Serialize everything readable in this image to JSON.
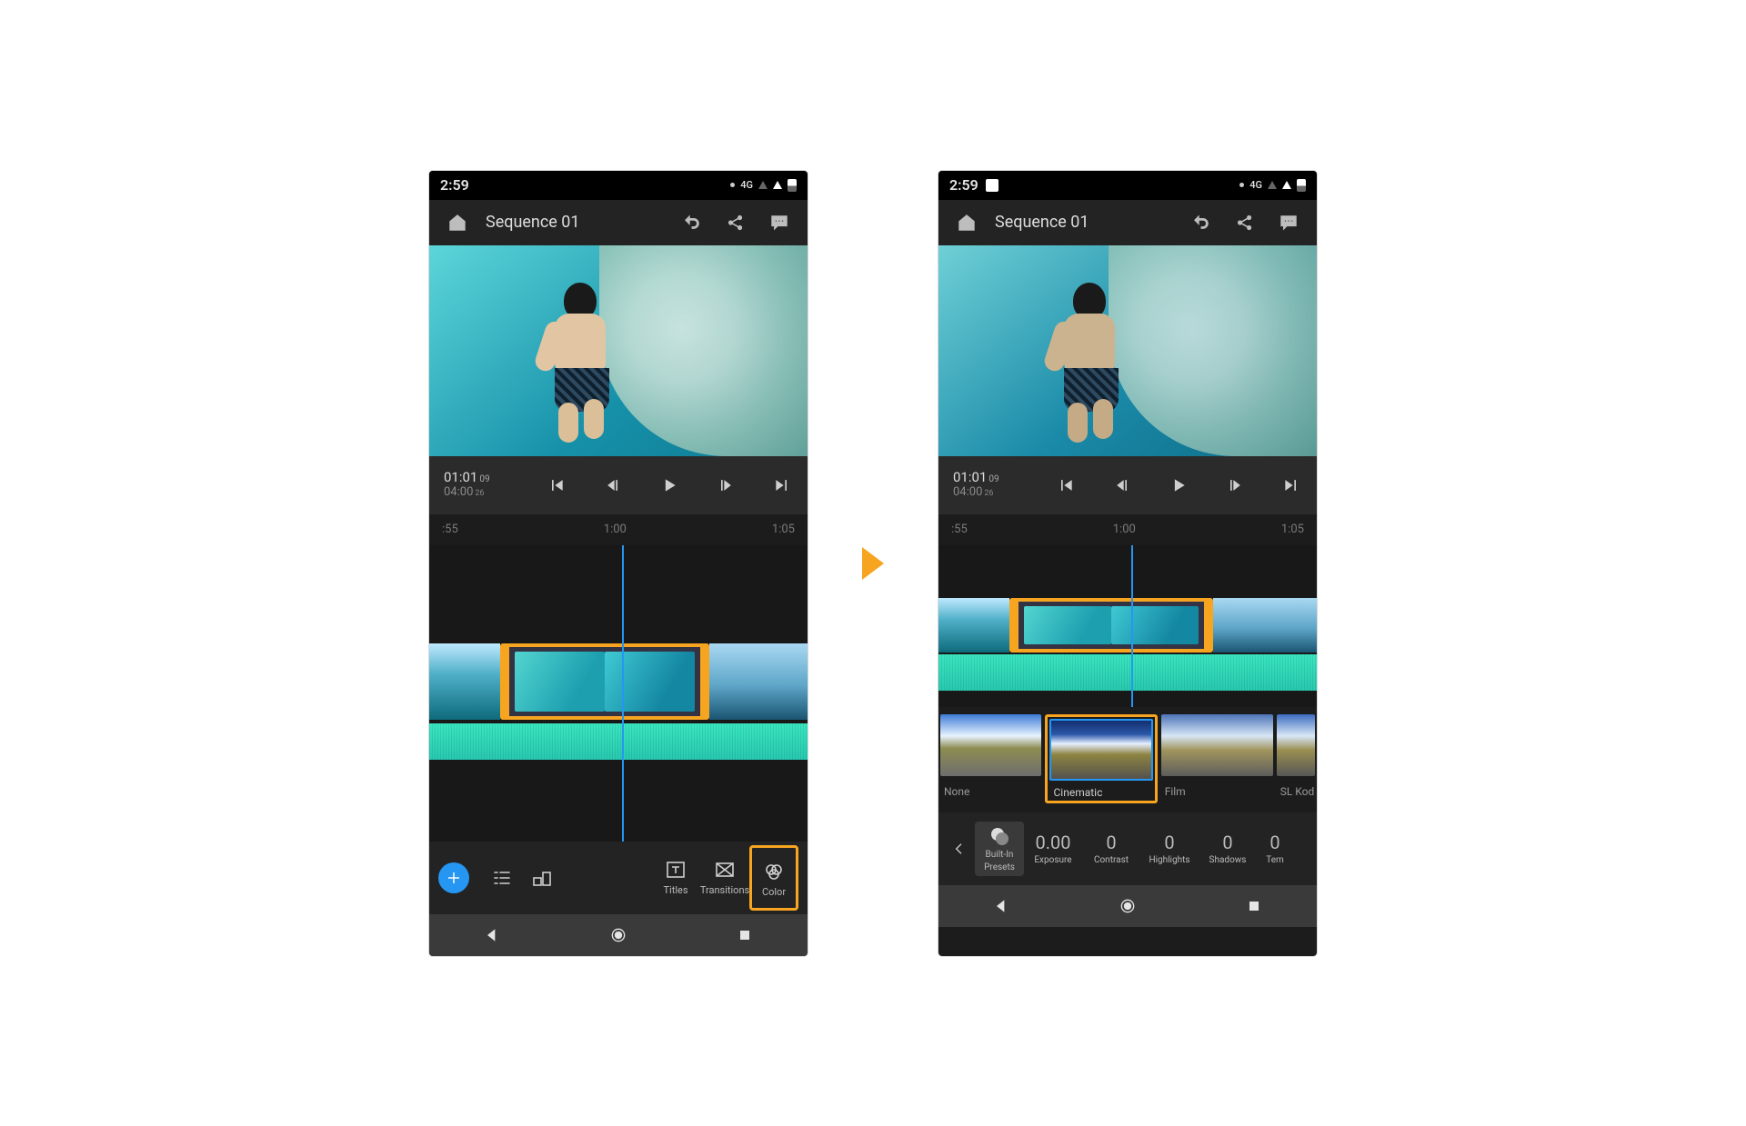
{
  "status": {
    "time": "2:59",
    "network": "4G"
  },
  "appbar": {
    "title": "Sequence 01"
  },
  "transport": {
    "tc": "01:01",
    "tc_frames": "09",
    "dur": "04:00",
    "dur_frames": "26"
  },
  "ruler": {
    "a": ":55",
    "b": "1:00",
    "c": "1:05"
  },
  "tools": {
    "titles": "Titles",
    "transitions": "Transitions",
    "color": "Color"
  },
  "presets": {
    "none": "None",
    "cinematic": "Cinematic",
    "film": "Film",
    "kodak": "SL Kod"
  },
  "color_controls": {
    "builtin1": "Built-In",
    "builtin2": "Presets",
    "exposure_lbl": "Exposure",
    "exposure_val": "0.00",
    "contrast_lbl": "Contrast",
    "contrast_val": "0",
    "highlights_lbl": "Highlights",
    "highlights_val": "0",
    "shadows_lbl": "Shadows",
    "shadows_val": "0",
    "temp_lbl": "Tem",
    "temp_val": "0"
  }
}
